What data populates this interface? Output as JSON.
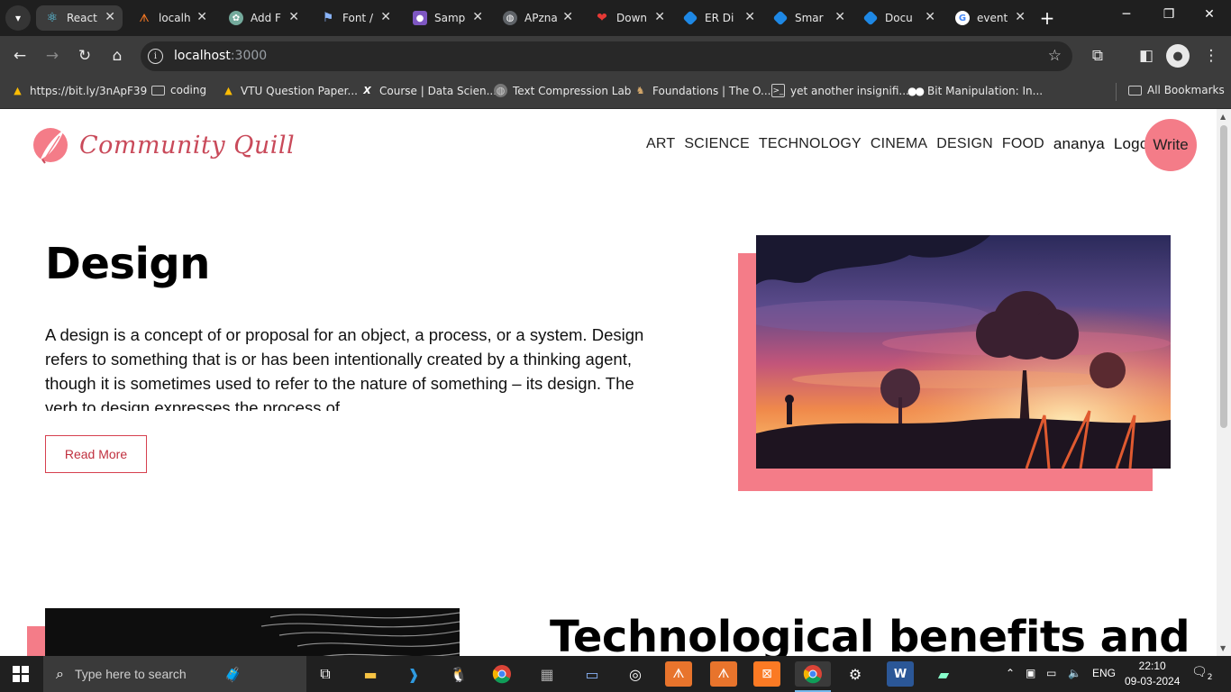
{
  "browser": {
    "tabs": [
      {
        "title": "React",
        "icon": "react-icon",
        "color": "#61dafb",
        "active": true
      },
      {
        "title": "localh",
        "icon": "xampp-icon",
        "color": "#fb7a24"
      },
      {
        "title": "Add F",
        "icon": "chatgpt-icon",
        "color": "#74aa9c"
      },
      {
        "title": "Font /",
        "icon": "flag-icon",
        "color": "#8ab4f8"
      },
      {
        "title": "Samp",
        "icon": "sample-icon",
        "color": "#7e57c2"
      },
      {
        "title": "APzna",
        "icon": "globe-icon",
        "color": "#9aa0a6"
      },
      {
        "title": "Down",
        "icon": "heart-icon",
        "color": "#e53935"
      },
      {
        "title": "ER Di",
        "icon": "diagram-icon",
        "color": "#1e88e5"
      },
      {
        "title": "Smar",
        "icon": "diagram-icon",
        "color": "#1e88e5"
      },
      {
        "title": "Docu",
        "icon": "diagram-icon",
        "color": "#1e88e5"
      },
      {
        "title": "event",
        "icon": "google-icon",
        "color": "#4285f4"
      }
    ],
    "url_host": "localhost",
    "url_port": ":3000",
    "bookmarks": [
      {
        "label": "https://bit.ly/3nApF39",
        "icon": "drive-icon"
      },
      {
        "label": "coding",
        "icon": "folder-icon"
      },
      {
        "label": "VTU Question Paper...",
        "icon": "drive-icon"
      },
      {
        "label": "Course | Data Scien...",
        "icon": "x-icon"
      },
      {
        "label": "Text Compression Lab",
        "icon": "globe-icon"
      },
      {
        "label": "Foundations | The O...",
        "icon": "odin-icon"
      },
      {
        "label": "yet another insignifi...",
        "icon": "terminal-icon"
      },
      {
        "label": "Bit Manipulation: In...",
        "icon": "medium-icon"
      }
    ],
    "all_bookmarks": "All Bookmarks"
  },
  "site": {
    "logo_text": "Community Quill",
    "nav": [
      "ART",
      "SCIENCE",
      "TECHNOLOGY",
      "CINEMA",
      "DESIGN",
      "FOOD"
    ],
    "user": "ananya",
    "logout": "Logout",
    "write": "Write",
    "accent_color": "#f47c88"
  },
  "posts": [
    {
      "title": "Design",
      "desc": "A design is a concept of or proposal for an object, a process, or a system. Design refers to something that is or has been intentionally created by a thinking agent, though it is sometimes used to refer to the nature of something – its design. The verb to design expresses the process of",
      "read_more": "Read More"
    },
    {
      "title": "Technological benefits and"
    }
  ],
  "taskbar": {
    "search_placeholder": "Type here to search",
    "lang": "ENG",
    "time": "22:10",
    "date": "09-03-2024",
    "notifications": "2"
  }
}
